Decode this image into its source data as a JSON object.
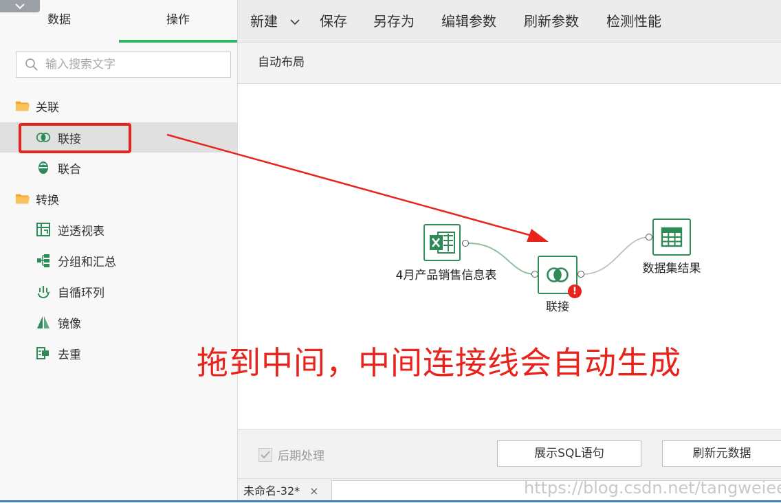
{
  "sidebar": {
    "tabs": [
      {
        "label": "数据",
        "active": false
      },
      {
        "label": "操作",
        "active": true
      }
    ],
    "search_placeholder": "输入搜索文字",
    "groups": [
      {
        "label": "关联",
        "items": [
          {
            "label": "联接",
            "icon": "join-icon",
            "selected": true
          },
          {
            "label": "联合",
            "icon": "union-icon",
            "selected": false
          }
        ]
      },
      {
        "label": "转换",
        "items": [
          {
            "label": "逆透视表",
            "icon": "unpivot-icon"
          },
          {
            "label": "分组和汇总",
            "icon": "group-summary-icon"
          },
          {
            "label": "自循环列",
            "icon": "self-loop-icon"
          },
          {
            "label": "镜像",
            "icon": "mirror-icon"
          },
          {
            "label": "去重",
            "icon": "dedupe-icon"
          }
        ]
      }
    ]
  },
  "toolbar": {
    "new_label": "新建",
    "save_label": "保存",
    "save_as_label": "另存为",
    "edit_params_label": "编辑参数",
    "refresh_params_label": "刷新参数",
    "check_perf_label": "检测性能"
  },
  "subbar": {
    "auto_layout_label": "自动布局"
  },
  "canvas": {
    "nodes": {
      "source": {
        "label": "4月产品销售信息表",
        "icon": "excel-icon"
      },
      "join": {
        "label": "联接",
        "icon": "join-icon",
        "error_badge": "!"
      },
      "result": {
        "label": "数据集结果",
        "icon": "table-icon"
      }
    },
    "annotation": "拖到中间，中间连接线会自动生成"
  },
  "bottom": {
    "post_process_label": "后期处理",
    "show_sql_label": "展示SQL语句",
    "refresh_meta_label": "刷新元数据"
  },
  "status": {
    "file_tab_label": "未命名-32*",
    "close_glyph": "×"
  },
  "watermark": "https://blog.csdn.net/tangweiee",
  "colors": {
    "accent": "#2fb560",
    "node_border": "#2e8b57",
    "annotation": "#e8231c"
  }
}
